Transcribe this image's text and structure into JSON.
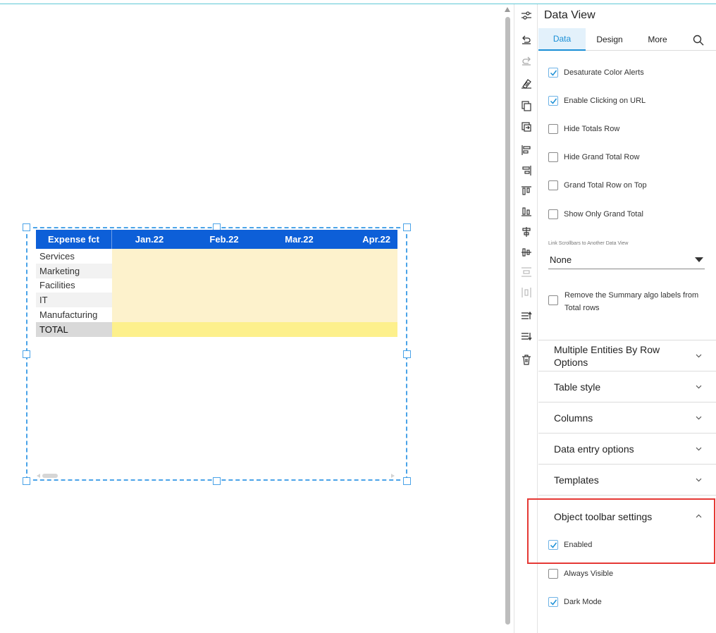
{
  "table": {
    "headers": [
      "Expense fct",
      "Jan.22",
      "Feb.22",
      "Mar.22",
      "Apr.22"
    ],
    "rows": [
      "Services",
      "Marketing",
      "Facilities",
      "IT",
      "Manufacturing"
    ],
    "total_label": "TOTAL"
  },
  "panel": {
    "title": "Data View",
    "tabs": [
      "Data",
      "Design",
      "More"
    ],
    "active_tab": "Data",
    "options": [
      {
        "label": "Desaturate Color Alerts",
        "checked": true
      },
      {
        "label": "Enable Clicking on URL",
        "checked": true
      },
      {
        "label": "Hide Totals Row",
        "checked": false
      },
      {
        "label": "Hide Grand Total Row",
        "checked": false
      },
      {
        "label": "Grand Total Row on Top",
        "checked": false
      },
      {
        "label": "Show Only Grand Total",
        "checked": false
      }
    ],
    "link_label": "Link Scrollbars to Another Data View",
    "link_value": "None",
    "summary_option": {
      "label": "Remove the Summary algo labels from Total rows",
      "checked": false
    },
    "sections": [
      "Multiple Entities By Row Options",
      "Table style",
      "Columns",
      "Data entry options",
      "Templates",
      "Object toolbar settings"
    ],
    "toolbar_options": [
      {
        "label": "Enabled",
        "checked": true
      },
      {
        "label": "Always Visible",
        "checked": false
      },
      {
        "label": "Dark Mode",
        "checked": true
      }
    ]
  },
  "colors": {
    "header_blue": "#0d5fd8",
    "cell_yellow": "#fdf2cc",
    "total_yellow": "#fdf08c",
    "accent": "#1a8fd6",
    "highlight_red": "#e53935"
  },
  "toolbar_icons": [
    "sliders-icon",
    "undo-icon",
    "redo-icon",
    "format-painter-icon",
    "copy-icon",
    "paste-icon",
    "align-left-icon",
    "align-right-icon",
    "align-top-icon",
    "align-bottom-icon",
    "align-center-horizontal-icon",
    "align-center-vertical-icon",
    "distribute-vertical-icon",
    "distribute-horizontal-icon",
    "bring-forward-icon",
    "send-backward-icon",
    "delete-icon"
  ]
}
